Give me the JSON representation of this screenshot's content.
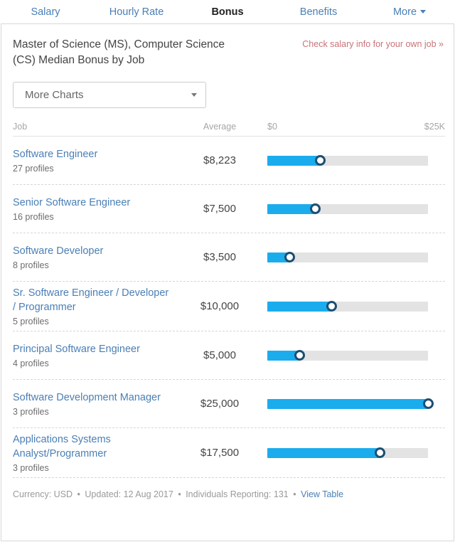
{
  "tabs": [
    {
      "label": "Salary",
      "active": false,
      "has_caret": false
    },
    {
      "label": "Hourly Rate",
      "active": false,
      "has_caret": false
    },
    {
      "label": "Bonus",
      "active": true,
      "has_caret": false
    },
    {
      "label": "Benefits",
      "active": false,
      "has_caret": false
    },
    {
      "label": "More",
      "active": false,
      "has_caret": true
    }
  ],
  "header": {
    "title": "Master of Science (MS), Computer Science (CS) Median Bonus by Job",
    "own_job_link": "Check salary info for your own job »"
  },
  "chart_select": {
    "value": "More Charts"
  },
  "columns": {
    "job": "Job",
    "average": "Average",
    "axis_min": "$0",
    "axis_max": "$25K"
  },
  "chart_data": {
    "type": "bar",
    "title": "Master of Science (MS), Computer Science (CS) Median Bonus by Job",
    "xlabel": "",
    "ylabel": "Job",
    "xlim": [
      0,
      25000
    ],
    "axis_tick_labels": [
      "$0",
      "$25K"
    ],
    "value_label_column": "Average",
    "grid": false,
    "legend": "none",
    "currency": "USD",
    "categories": [
      "Software Engineer",
      "Senior Software Engineer",
      "Software Developer",
      "Sr. Software Engineer / Developer / Programmer",
      "Principal Software Engineer",
      "Software Development Manager",
      "Applications Systems Analyst/Programmer"
    ],
    "values": [
      8223,
      7500,
      3500,
      10000,
      5000,
      25000,
      17500
    ],
    "value_labels": [
      "$8,223",
      "$7,500",
      "$3,500",
      "$10,000",
      "$5,000",
      "$25,000",
      "$17,500"
    ],
    "profile_counts": [
      27,
      16,
      8,
      5,
      4,
      3,
      3
    ],
    "bar_color": "#1bacee",
    "track_color": "#e3e3e3"
  },
  "rows": [
    {
      "job": "Software Engineer",
      "profiles": "27 profiles",
      "average": "$8,223",
      "value": 8223,
      "pct": 32.9
    },
    {
      "job": "Senior Software Engineer",
      "profiles": "16 profiles",
      "average": "$7,500",
      "value": 7500,
      "pct": 30.0
    },
    {
      "job": "Software Developer",
      "profiles": "8 profiles",
      "average": "$3,500",
      "value": 3500,
      "pct": 14.0
    },
    {
      "job": "Sr. Software Engineer / Developer / Programmer",
      "profiles": "5 profiles",
      "average": "$10,000",
      "value": 10000,
      "pct": 40.0
    },
    {
      "job": "Principal Software Engineer",
      "profiles": "4 profiles",
      "average": "$5,000",
      "value": 5000,
      "pct": 20.0
    },
    {
      "job": "Software Development Manager",
      "profiles": "3 profiles",
      "average": "$25,000",
      "value": 25000,
      "pct": 100.0
    },
    {
      "job": "Applications Systems Analyst/Programmer",
      "profiles": "3 profiles",
      "average": "$17,500",
      "value": 17500,
      "pct": 70.0
    }
  ],
  "footer": {
    "currency": "Currency: USD",
    "updated": "Updated: 12 Aug 2017",
    "reporting": "Individuals Reporting: 131",
    "view_table": "View Table",
    "separator": "•"
  }
}
